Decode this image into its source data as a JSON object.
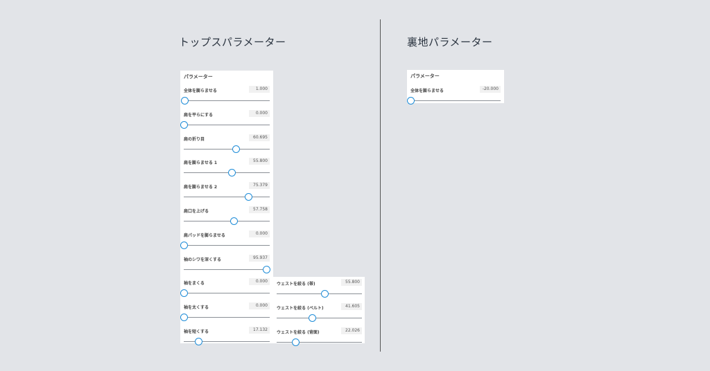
{
  "headings": {
    "top": "トップスパラメーター",
    "back": "裏地パラメーター"
  },
  "panel_title": "パラメーター",
  "tops_params": [
    {
      "label": "全体を膨らませる",
      "value": "1.000",
      "level": 0.01
    },
    {
      "label": "肩を平らにする",
      "value": "0.000",
      "level": 0.0
    },
    {
      "label": "肩の折り目",
      "value": "60.695",
      "level": 0.60695
    },
    {
      "label": "肩を膨らませる 1",
      "value": "55.800",
      "level": 0.558
    },
    {
      "label": "肩を膨らませる 2",
      "value": "75.379",
      "level": 0.75379
    },
    {
      "label": "肩口を上げる",
      "value": "57.758",
      "level": 0.57758
    },
    {
      "label": "肩パッドを膨らませる",
      "value": "0.000",
      "level": 0.0
    },
    {
      "label": "袖のシワを深くする",
      "value": "95.937",
      "level": 0.95937
    },
    {
      "label": "袖をまくる",
      "value": "0.000",
      "level": 0.0
    },
    {
      "label": "袖を太くする",
      "value": "0.000",
      "level": 0.0
    },
    {
      "label": "袖を短くする",
      "value": "17.132",
      "level": 0.17132
    }
  ],
  "waist_params": [
    {
      "label": "ウェストを絞る (帯)",
      "value": "55.800",
      "level": 0.558
    },
    {
      "label": "ウェストを絞る (ベルト)",
      "value": "41.605",
      "level": 0.41605
    },
    {
      "label": "ウェストを絞る (背面)",
      "value": "22.026",
      "level": 0.22026
    }
  ],
  "back_params": [
    {
      "label": "全体を膨らませる",
      "value": "-20.000",
      "level": 0.0
    }
  ]
}
